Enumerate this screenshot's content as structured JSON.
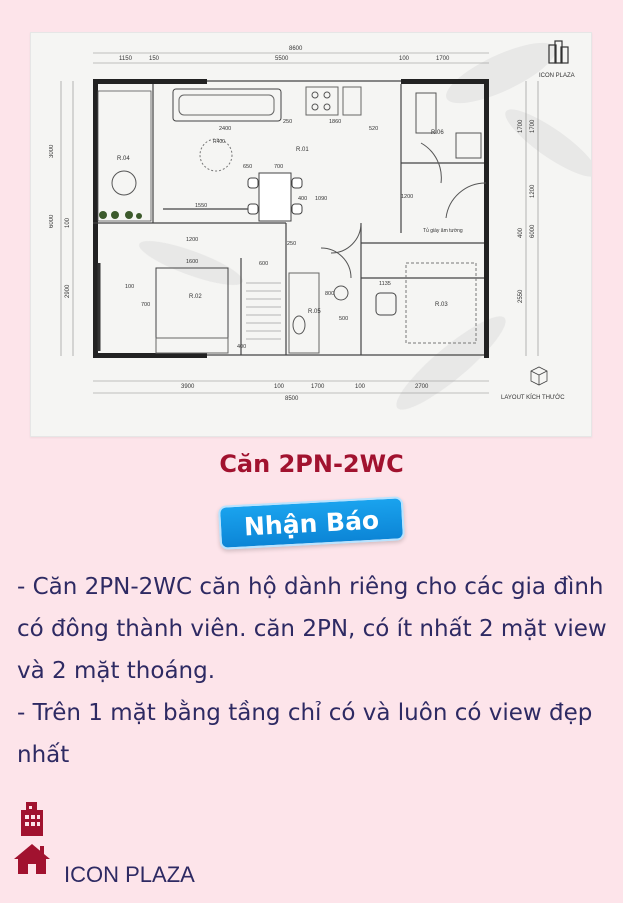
{
  "floorplan": {
    "logo_text": "ICON PLAZA",
    "layout_caption": "LAYOUT KÍCH THƯỚC",
    "dims_top": [
      "8600",
      "1150",
      "150",
      "5500",
      "100",
      "1700"
    ],
    "dims_bottom": [
      "3900",
      "100",
      "1700",
      "100",
      "2700",
      "8500"
    ],
    "dims_left": [
      "3000",
      "6000",
      "2900",
      "100"
    ],
    "dims_right": [
      "1700",
      "1200",
      "1700",
      "400",
      "2550",
      "6000"
    ],
    "room_labels": [
      "R.01",
      "R.02",
      "R.03",
      "R.04",
      "R.05",
      "R.06"
    ],
    "inner_dims": [
      "2400",
      "250",
      "1860",
      "520",
      "650",
      "700",
      "400",
      "1090",
      "1550",
      "1200",
      "1600",
      "600",
      "250",
      "700",
      "800",
      "500",
      "1135",
      "1200",
      "400",
      "100"
    ],
    "closet_label": "Tủ giày âm tường",
    "radius_label": "R400"
  },
  "unit_title": "Căn 2PN-2WC",
  "notify_button": "Nhận Báo",
  "description": [
    "- Căn 2PN-2WC căn hộ dành riêng cho các gia đình có đông thành viên. căn 2PN, có ít nhất 2 mặt view và 2 mặt thoáng.",
    "- Trên 1 mặt bằng tầng chỉ có và luôn có view đẹp nhất"
  ],
  "footer": {
    "building_icon": "building-icon",
    "home_icon": "home-icon",
    "project_name": "ICON PLAZA"
  },
  "colors": {
    "background": "#fde4ea",
    "title": "#a1122f",
    "text": "#2e2a63",
    "button": "#0c85d6",
    "icon": "#a1122f"
  }
}
